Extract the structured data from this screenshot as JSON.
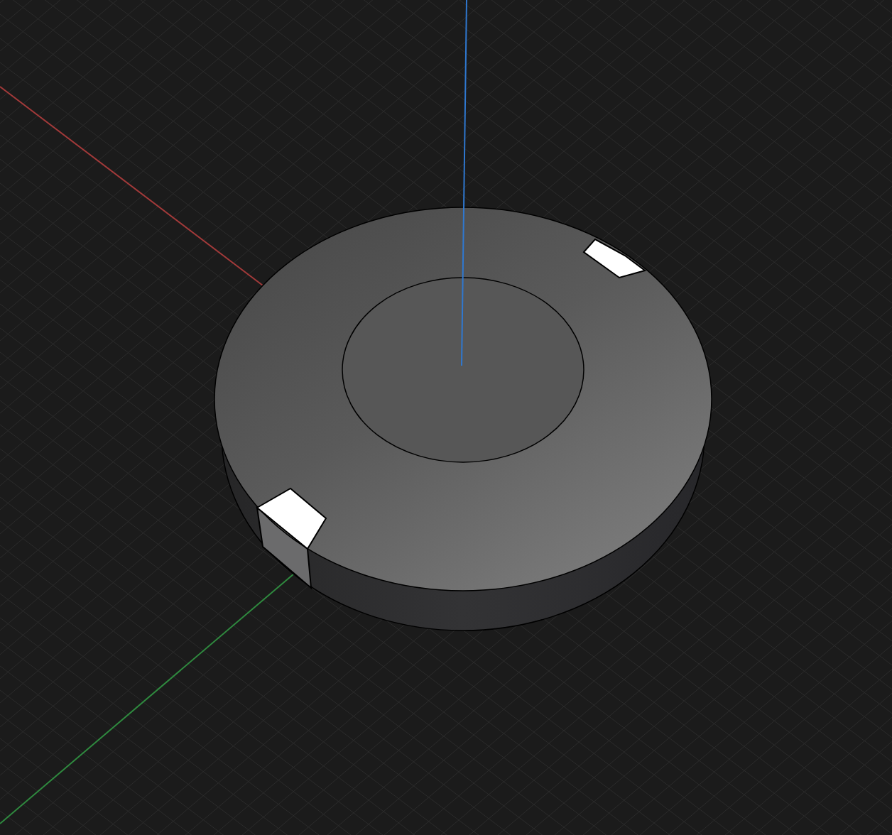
{
  "viewport": {
    "grid": true,
    "axes": [
      {
        "color": "#a33a3a"
      },
      {
        "color": "#2f8a3f"
      },
      {
        "color": "#2f78d0"
      }
    ]
  }
}
